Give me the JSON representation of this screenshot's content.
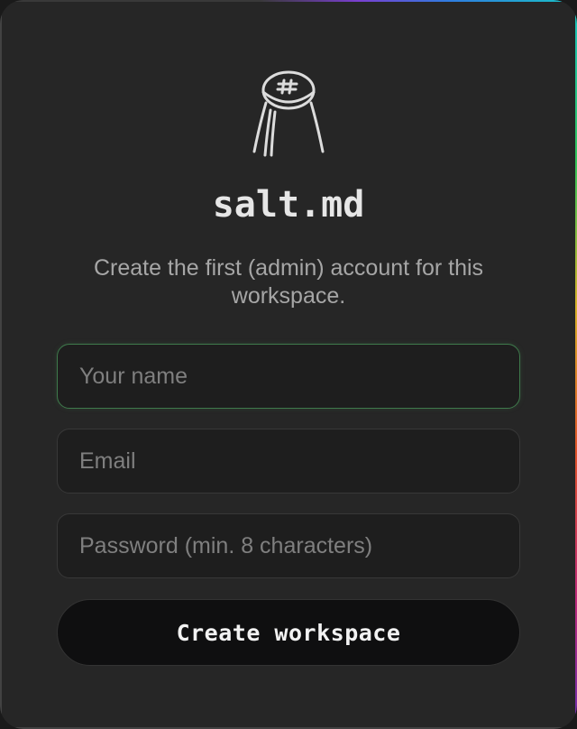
{
  "brand": {
    "logo_icon": "salt-shaker-icon",
    "name": "salt.md"
  },
  "intro": {
    "text": "Create the first (admin) account for this workspace."
  },
  "form": {
    "name_field": {
      "placeholder": "Your name",
      "value": ""
    },
    "email_field": {
      "placeholder": "Email",
      "value": ""
    },
    "password_field": {
      "placeholder": "Password (min. 8 characters)",
      "value": ""
    },
    "submit_label": "Create workspace"
  },
  "colors": {
    "background": "#262626",
    "focus_border": "#3f7a4c",
    "button_bg": "#0f0f10"
  }
}
